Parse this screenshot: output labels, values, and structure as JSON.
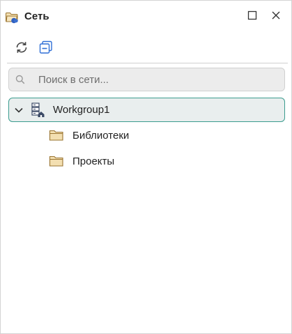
{
  "window": {
    "title": "Сеть",
    "title_icon": "network-folder-icon",
    "maximize_icon": "maximize-icon",
    "close_icon": "close-icon"
  },
  "toolbar": {
    "refresh_icon": "refresh-icon",
    "collapse_icon": "collapse-all-icon"
  },
  "search": {
    "placeholder": "Поиск в сети...",
    "value": "",
    "icon": "search-icon"
  },
  "tree": {
    "root": {
      "label": "Workgroup1",
      "expanded": true,
      "selected": true,
      "icon": "server-icon"
    },
    "children": [
      {
        "label": "Библиотеки",
        "icon": "folder-icon"
      },
      {
        "label": "Проекты",
        "icon": "folder-icon"
      }
    ]
  },
  "colors": {
    "accent_border": "#3a9c8e",
    "selected_bg": "#e9eeee",
    "folder_fill": "#f3dfb1",
    "folder_stroke": "#9a7430",
    "icon_blue": "#2f6fd6"
  }
}
